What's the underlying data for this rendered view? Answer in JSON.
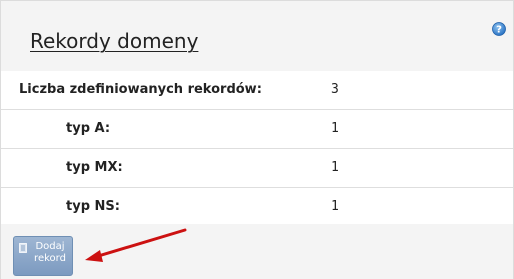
{
  "panel": {
    "title": "Rekordy domeny",
    "help_icon": "help-icon"
  },
  "records": {
    "total_label": "Liczba zdefiniowanych rekordów:",
    "total_value": "3",
    "items": [
      {
        "label": "typ A:",
        "value": "1"
      },
      {
        "label": "typ MX:",
        "value": "1"
      },
      {
        "label": "typ NS:",
        "value": "1"
      }
    ]
  },
  "footer": {
    "add_button_line1": "Dodaj",
    "add_button_line2": "rekord",
    "add_button_icon": "document-icon",
    "annotation_icon": "red-arrow-icon"
  },
  "colors": {
    "header_bg": "#f4f4f4",
    "button_bg": "#8aa6c9",
    "arrow": "#cc1111"
  }
}
